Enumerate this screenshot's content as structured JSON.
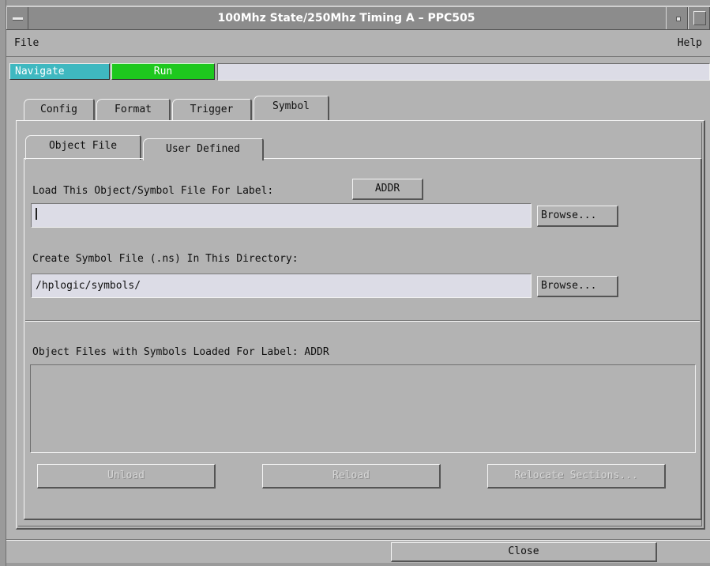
{
  "window": {
    "title": "100Mhz State/250Mhz Timing A – PPC505"
  },
  "menu": {
    "file": "File",
    "help": "Help"
  },
  "toolbar": {
    "navigate": "Navigate",
    "run": "Run",
    "status_text": ""
  },
  "tabs": [
    {
      "label": "Config"
    },
    {
      "label": "Format"
    },
    {
      "label": "Trigger"
    },
    {
      "label": "Symbol"
    }
  ],
  "active_tab": "Symbol",
  "subtabs": [
    {
      "label": "Object File"
    },
    {
      "label": "User Defined"
    }
  ],
  "active_subtab": "Object File",
  "object_file": {
    "load_label": "Load This Object/Symbol File For Label:",
    "label_button": "ADDR",
    "load_path": "",
    "browse1": "Browse...",
    "create_label": "Create Symbol File (.ns) In This Directory:",
    "create_path": "/hplogic/symbols/",
    "browse2": "Browse...",
    "loaded_heading": "Object Files with Symbols Loaded For Label: ADDR",
    "loaded_files": [],
    "unload": "Unload",
    "reload": "Reload",
    "relocate": "Relocate Sections..."
  },
  "footer": {
    "close": "Close"
  },
  "colors": {
    "background": "#b3b3b3",
    "titlebar": "#8c8c8c",
    "navigate": "#3fb8c0",
    "run": "#1ec81e",
    "field": "#dcdce6"
  }
}
